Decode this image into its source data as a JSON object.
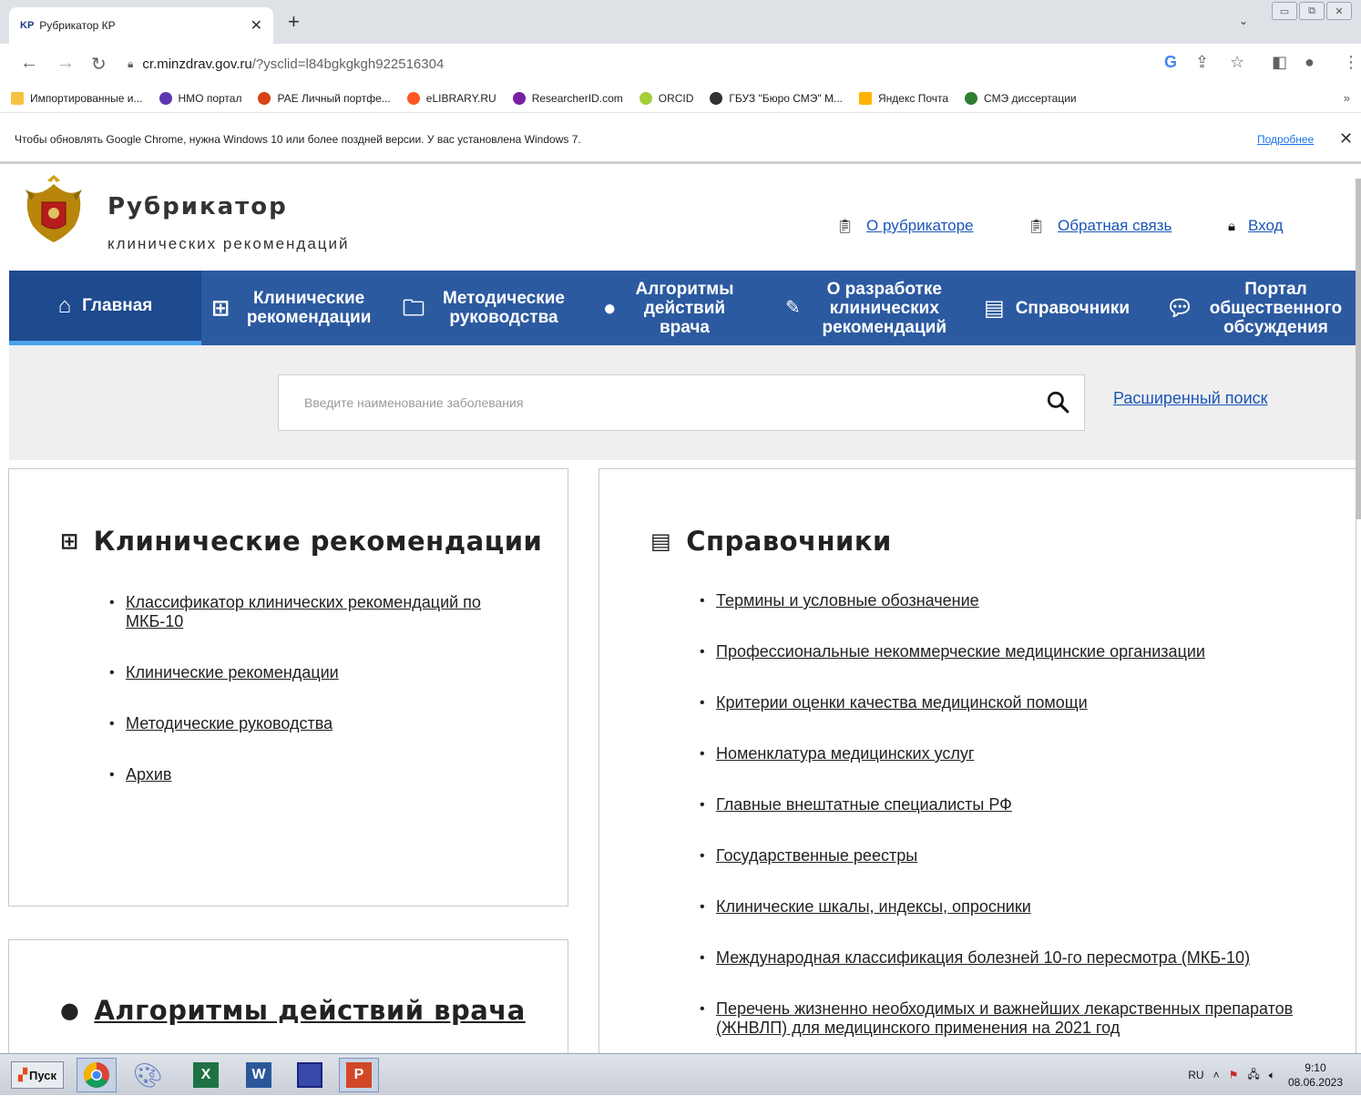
{
  "browser": {
    "tab_favicon": "KP",
    "tab_title": "Рубрикатор КР",
    "url_host": "cr.minzdrav.gov.ru",
    "url_path": "/?ysclid=l84bgkgkgh922516304",
    "bookmarks": [
      {
        "label": "Импортированные и...",
        "color": "#f5c242"
      },
      {
        "label": "НМО портал",
        "color": "#5e35b1"
      },
      {
        "label": "РАЕ Личный портфе...",
        "color": "#d84315"
      },
      {
        "label": "eLIBRARY.RU",
        "color": "#ff5722"
      },
      {
        "label": "ResearcherID.com",
        "color": "#7b1fa2"
      },
      {
        "label": "ORCID",
        "color": "#a6ce39"
      },
      {
        "label": "ГБУЗ \"Бюро СМЭ\" М...",
        "color": "#333333"
      },
      {
        "label": "Яндекс Почта",
        "color": "#ffb300"
      },
      {
        "label": "СМЭ диссертации",
        "color": "#2e7d32"
      }
    ],
    "bookmarks_more": "»",
    "infobar_message": "Чтобы обновлять Google Chrome, нужна Windows 10 или более поздней версии. У вас установлена Windows 7.",
    "infobar_link": "Подробнее"
  },
  "header": {
    "title": "Рубрикатор",
    "subtitle": "клинических рекомендаций",
    "links": {
      "about": "О рубрикаторе",
      "feedback": "Обратная связь",
      "login": "Вход"
    }
  },
  "nav": {
    "home": "Главная",
    "clinical": "Клинические рекомендации",
    "methodical": "Методические руководства",
    "algorithms": "Алгоритмы действий врача",
    "development": "О разработке клинических рекомендаций",
    "references": "Справочники",
    "portal": "Портал общественного обсуждения"
  },
  "search": {
    "placeholder": "Введите наименование заболевания",
    "advanced": "Расширенный поиск"
  },
  "clinical_panel": {
    "title": "Клинические рекомендации",
    "items": [
      "Классификатор клинических рекомендаций по МКБ-10",
      "Клинические рекомендации",
      "Методические руководства",
      "Архив"
    ]
  },
  "algorithms_panel": {
    "title": "Алгоритмы действий врача"
  },
  "references_panel": {
    "title": "Справочники",
    "items": [
      "Термины и условные обозначение",
      "Профессиональные некоммерческие медицинские организации",
      "Критерии оценки качества медицинской помощи",
      "Номенклатура медицинских услуг",
      "Главные внештатные специалисты РФ",
      "Государственные реестры",
      "Клинические шкалы, индексы, опросники",
      "Международная классификация болезней 10-го пересмотра (МКБ-10)",
      "Перечень жизненно необходимых и важнейших лекарственных препаратов (ЖНВЛП) для медицинского применения на 2021 год"
    ]
  },
  "taskbar": {
    "start": "Пуск",
    "lang": "RU",
    "time": "9:10",
    "date": "08.06.2023"
  },
  "colors": {
    "nav_bg": "#2c5aa0",
    "nav_active_underline": "#4aa3ef",
    "link": "#1a56b8"
  }
}
